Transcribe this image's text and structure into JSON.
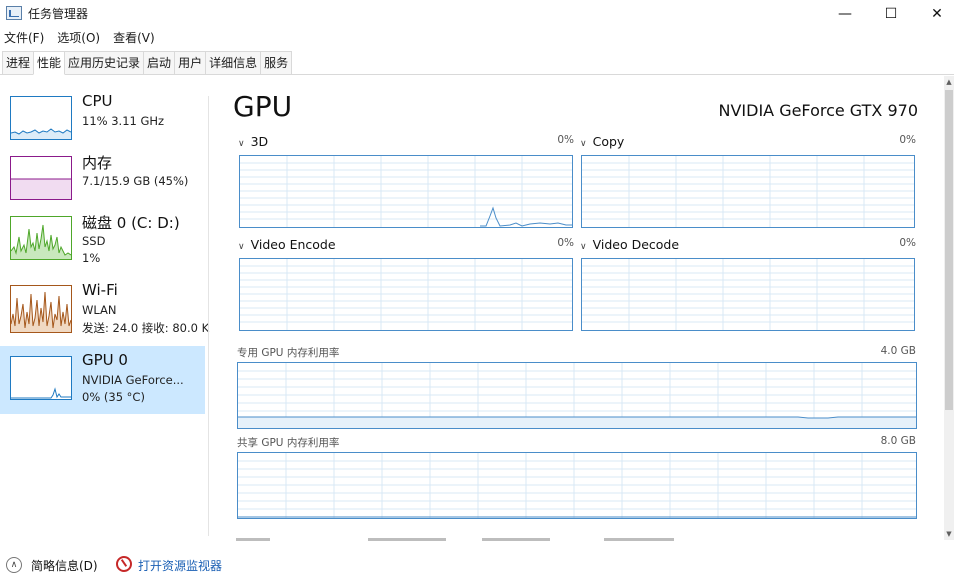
{
  "window": {
    "title": "任务管理器",
    "minimize": "—",
    "maximize": "☐",
    "close": "✕"
  },
  "menu": [
    "文件(F)",
    "选项(O)",
    "查看(V)"
  ],
  "tabs": [
    {
      "label": "进程",
      "active": false
    },
    {
      "label": "性能",
      "active": true
    },
    {
      "label": "应用历史记录",
      "active": false
    },
    {
      "label": "启动",
      "active": false
    },
    {
      "label": "用户",
      "active": false
    },
    {
      "label": "详细信息",
      "active": false
    },
    {
      "label": "服务",
      "active": false
    }
  ],
  "resources": [
    {
      "name": "CPU",
      "line1": "11%  3.11 GHz",
      "line2": "",
      "color": "#1f7ac2",
      "selected": false
    },
    {
      "name": "内存",
      "line1": "7.1/15.9 GB (45%)",
      "line2": "",
      "color": "#8b1a8b",
      "selected": false
    },
    {
      "name": "磁盘 0 (C: D:)",
      "line1": "SSD",
      "line2": "1%",
      "color": "#4ea72a",
      "selected": false
    },
    {
      "name": "Wi-Fi",
      "line1": "WLAN",
      "line2": "发送: 24.0  接收: 80.0 K",
      "color": "#a5571b",
      "selected": false
    },
    {
      "name": "GPU 0",
      "line1": "NVIDIA GeForce...",
      "line2": "0%  (35 °C)",
      "color": "#1f7ac2",
      "selected": true
    }
  ],
  "detail": {
    "title": "GPU",
    "model": "NVIDIA GeForce GTX 970",
    "engines": [
      {
        "label": "3D",
        "pct": "0%"
      },
      {
        "label": "Copy",
        "pct": "0%"
      },
      {
        "label": "Video Encode",
        "pct": "0%"
      },
      {
        "label": "Video Decode",
        "pct": "0%"
      }
    ],
    "dedicated": {
      "label": "专用 GPU 内存利用率",
      "value": "4.0 GB"
    },
    "shared": {
      "label": "共享 GPU 内存利用率",
      "value": "8.0 GB"
    }
  },
  "bottom": {
    "brief": "简略信息(D)",
    "monitor": "打开资源监视器"
  },
  "colors": {
    "graph_border": "#4a8dc9",
    "graph_grid": "#d8e8f5",
    "selected_bg": "#cce8ff",
    "link": "#1a5fb4"
  }
}
